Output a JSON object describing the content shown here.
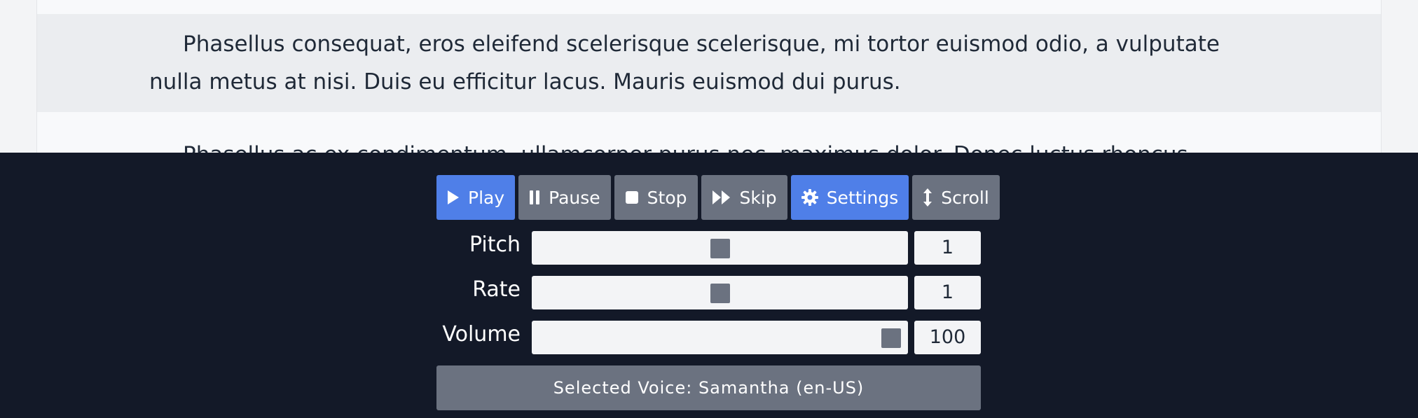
{
  "content": {
    "paragraph_highlighted": "Phasellus consequat, eros eleifend scelerisque scelerisque, mi tortor euismod odio, a vulputate nulla metus at nisi. Duis eu efficitur lacus. Mauris euismod dui purus.",
    "paragraph_next": "Phasellus ac ex condimentum, ullamcorper purus nec, maximus dolor. Donec luctus rhoncus arcu, id"
  },
  "player": {
    "buttons": {
      "play": "Play",
      "pause": "Pause",
      "stop": "Stop",
      "skip": "Skip",
      "settings": "Settings",
      "scroll": "Scroll"
    },
    "icons": {
      "play": "play-icon",
      "pause": "pause-icon",
      "stop": "stop-icon",
      "skip": "skip-icon",
      "settings": "gear-icon",
      "scroll": "vertical-arrows-icon"
    },
    "controls": {
      "pitch": {
        "label": "Pitch",
        "value": "1",
        "fraction": 0.5
      },
      "rate": {
        "label": "Rate",
        "value": "1",
        "fraction": 0.5
      },
      "volume": {
        "label": "Volume",
        "value": "100",
        "fraction": 1.0
      }
    },
    "voice": "Selected Voice: Samantha (en-US)"
  },
  "colors": {
    "player_background": "#131928",
    "primary_button": "#4f7fe8",
    "secondary_button": "#6b7280",
    "highlight_paragraph": "#ebedf0"
  }
}
